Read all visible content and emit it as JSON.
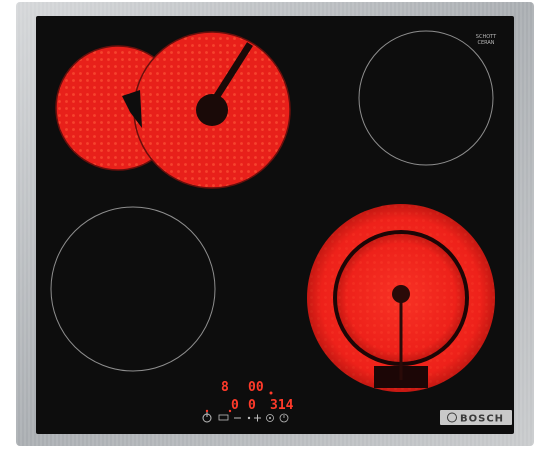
{
  "product": {
    "type": "ceramic electric hob",
    "brand_label": "BOSCH",
    "glass_label_top": "SCHOTT",
    "glass_label_bottom": "CERAN"
  },
  "colors": {
    "frame": "#b9bcbf",
    "glass": "#0d0d0d",
    "heated_zone": "#e8201a",
    "zone_outline": "#9a9a9a",
    "display_red": "#ff3a2a",
    "brand_plate": "#c9c9c9"
  },
  "zones": [
    {
      "name": "front-left",
      "state": "off"
    },
    {
      "name": "rear-left-dual",
      "state": "heating"
    },
    {
      "name": "rear-right",
      "state": "off"
    },
    {
      "name": "front-right-dual-ring",
      "state": "heating"
    }
  ],
  "display": {
    "row1_left": "8",
    "row1_right": "00",
    "row2_left": "0",
    "row2_right": "0",
    "row2_timer": "314"
  },
  "controls": [
    {
      "icon": "power-icon"
    },
    {
      "icon": "zone-select-icon"
    },
    {
      "icon": "minus-icon"
    },
    {
      "icon": "slider-dot-icon"
    },
    {
      "icon": "plus-icon"
    },
    {
      "icon": "lock-icon"
    },
    {
      "icon": "timer-icon"
    }
  ]
}
